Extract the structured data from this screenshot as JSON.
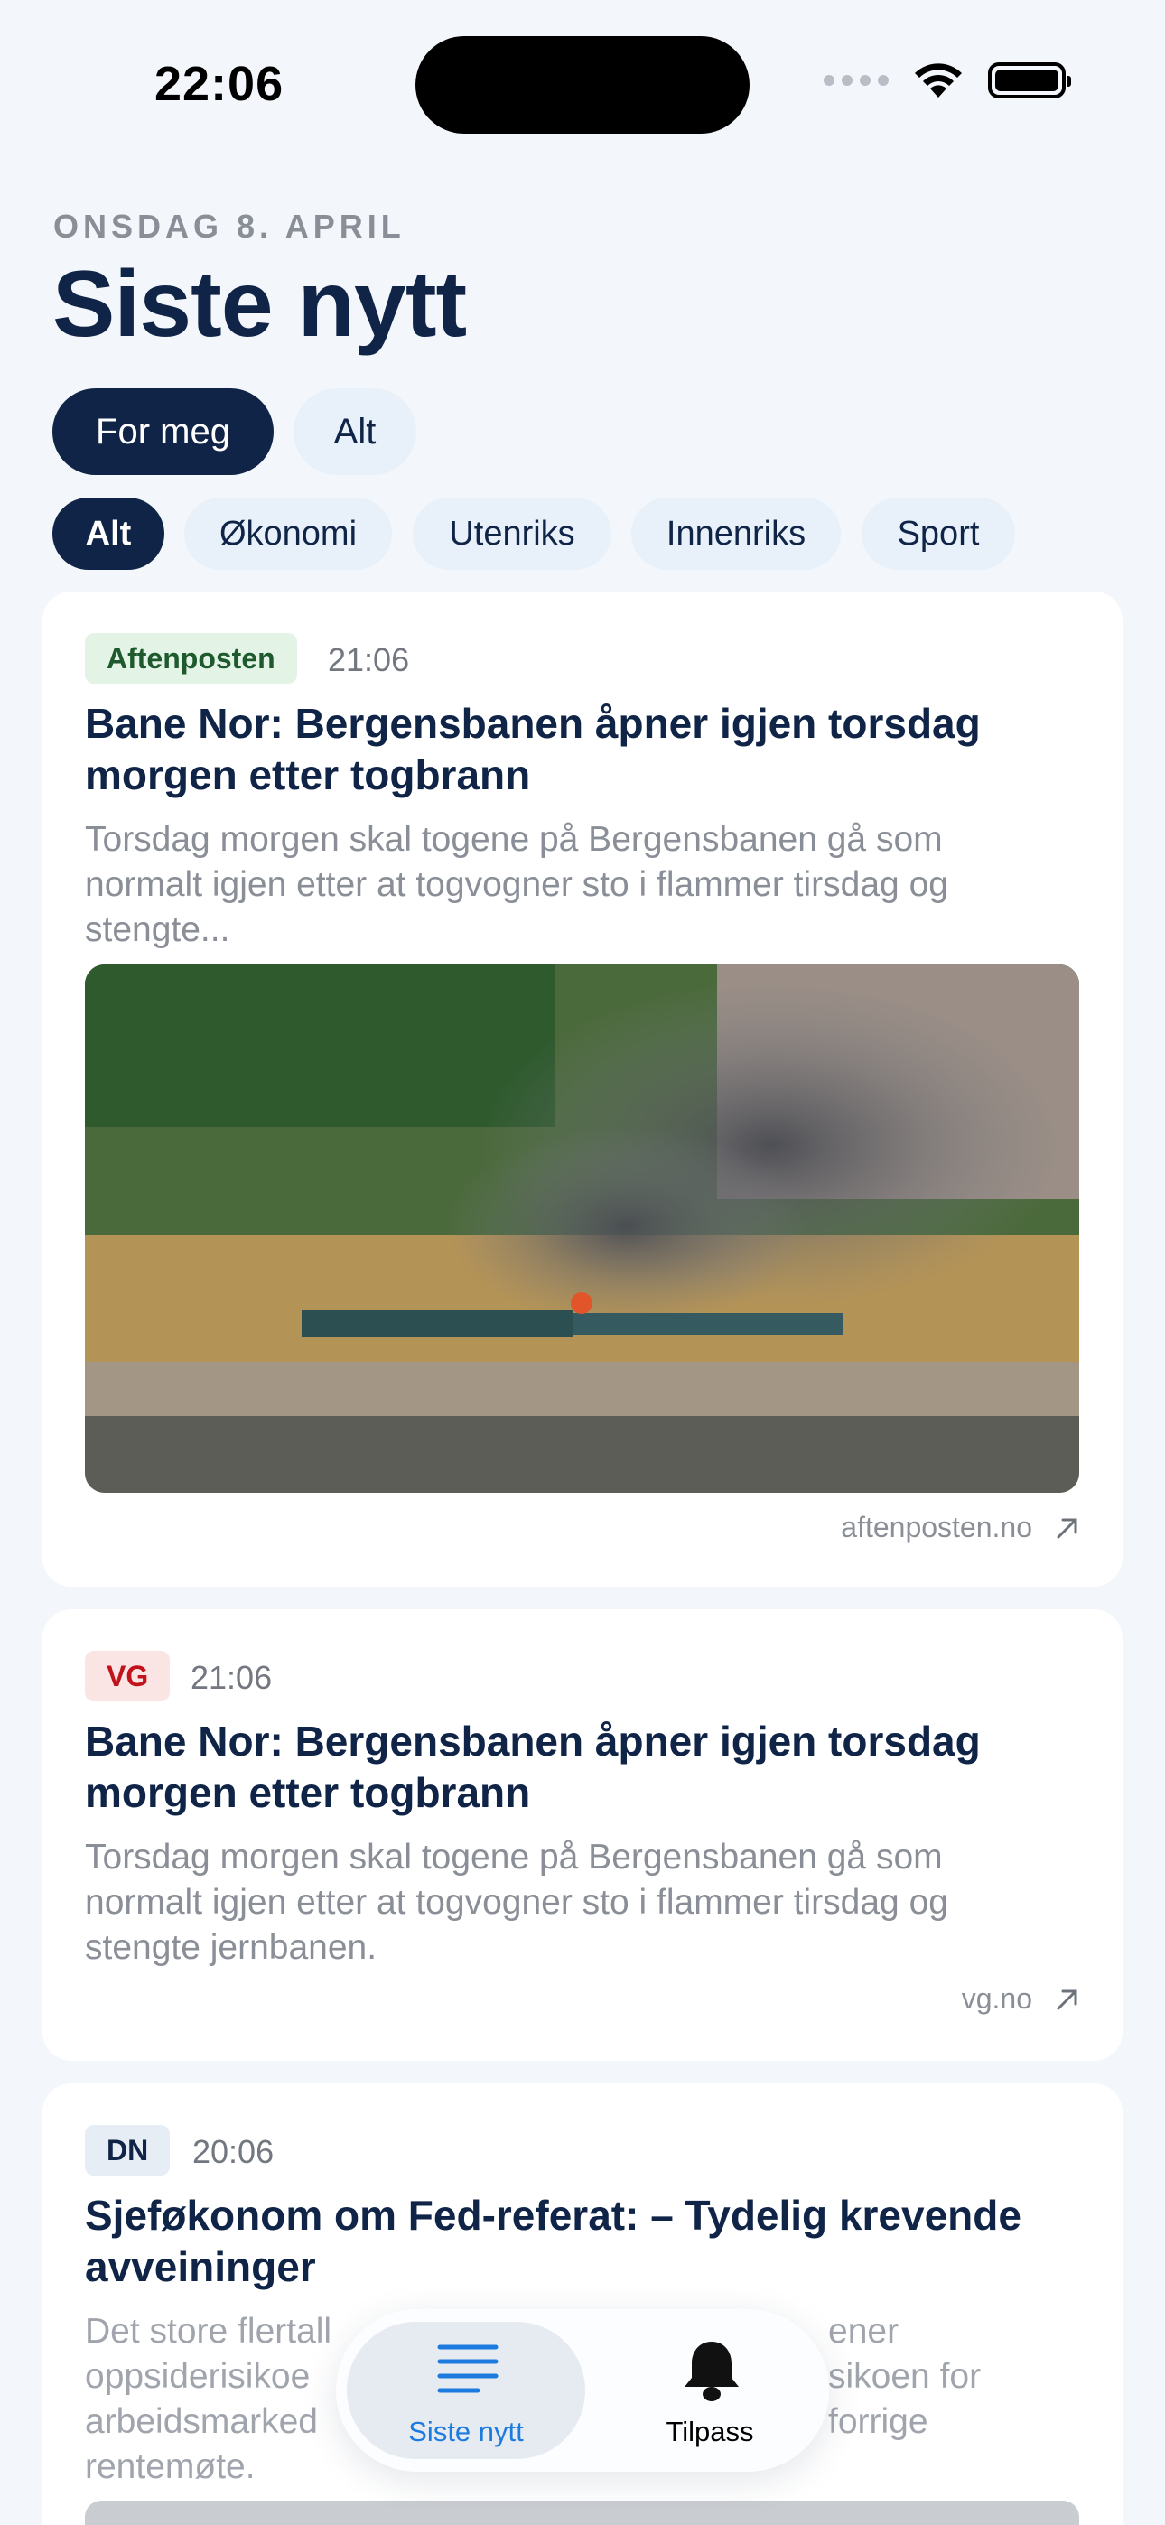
{
  "status_bar": {
    "time": "22:06"
  },
  "header": {
    "date": "ONSDAG 8. APRIL",
    "title": "Siste nytt"
  },
  "segments": [
    {
      "label": "For meg",
      "active": true
    },
    {
      "label": "Alt",
      "active": false
    }
  ],
  "categories": [
    {
      "label": "Alt",
      "active": true
    },
    {
      "label": "Økonomi",
      "active": false
    },
    {
      "label": "Utenriks",
      "active": false
    },
    {
      "label": "Innenriks",
      "active": false
    },
    {
      "label": "Sport",
      "active": false
    }
  ],
  "articles": [
    {
      "source_badge": "Aftenposten",
      "time": "21:06",
      "headline_line1": "Bane Nor: Bergensbanen åpner igjen torsdag",
      "headline_line2": "morgen etter togbrann",
      "summary_lines": [
        "Torsdag morgen skal togene på Bergensbanen gå som",
        "normalt igjen etter at togvogner sto i flammer tirsdag og",
        "stengte..."
      ],
      "link": "aftenposten.no",
      "badge_color": "#e3f3e6",
      "badge_text_color": "#1e5a2d"
    },
    {
      "source_badge": "VG",
      "time": "21:06",
      "headline_line1": "Bane Nor: Bergensbanen åpner igjen torsdag",
      "headline_line2": "morgen etter togbrann",
      "summary_lines": [
        "Torsdag morgen skal togene på Bergensbanen gå som",
        "normalt igjen etter at togvogner sto i flammer tirsdag og",
        "stengte jernbanen."
      ],
      "link": "vg.no",
      "badge_color": "#fbe4e4",
      "badge_text_color": "#c0131b"
    },
    {
      "source_badge": "DN",
      "time": "20:06",
      "headline_line1": "Sjeføkonom om Fed-referat: – Tydelig krevende",
      "headline_line2": "avveininger",
      "summary_lines": [
        "Det store flertall",
        "oppsiderisikoe",
        "arbeidsmarked",
        "rentemøte."
      ],
      "summary_right_lines": [
        "ener",
        "sikoen for",
        "forrige"
      ],
      "badge_color": "#e6edf5",
      "badge_text_color": "#0f2447"
    }
  ],
  "tab_bar": {
    "tabs": [
      {
        "label": "Siste nytt",
        "icon": "list-icon",
        "active": true
      },
      {
        "label": "Tilpass",
        "icon": "bell-icon",
        "active": false
      }
    ]
  },
  "colors": {
    "navy": "#0f2447",
    "accent_blue": "#1d7be0",
    "background": "#f3f6fa"
  }
}
